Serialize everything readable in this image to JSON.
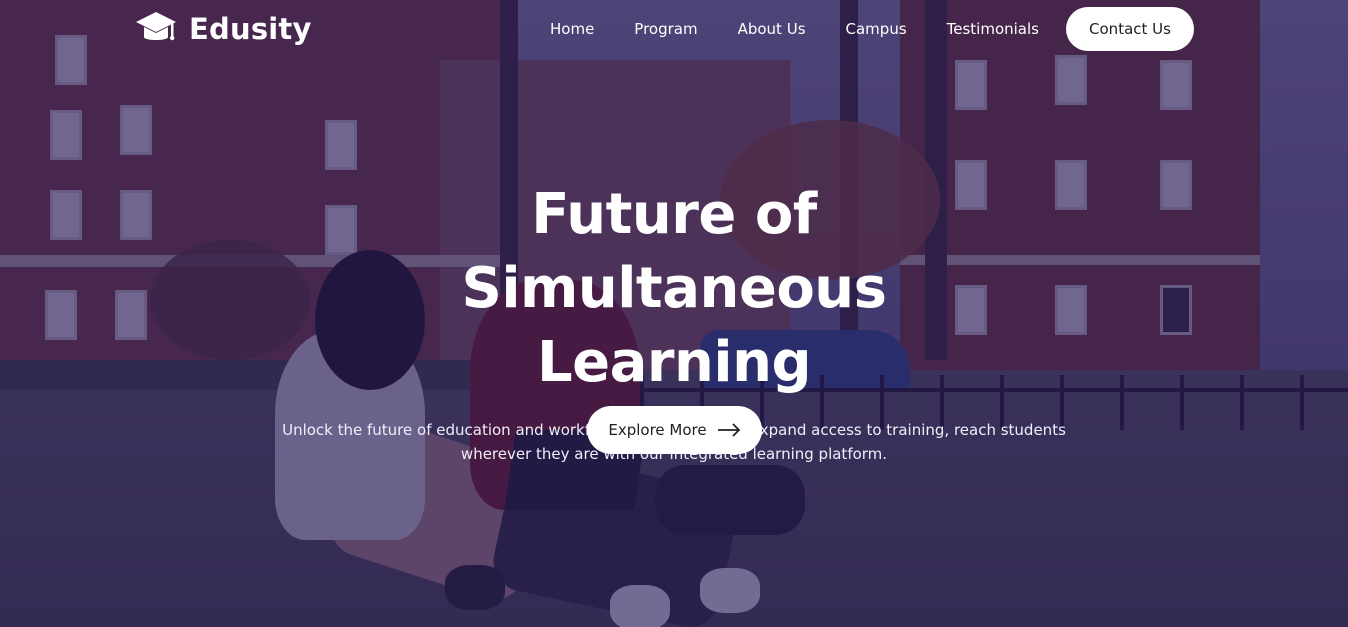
{
  "brand": {
    "name": "Edusity",
    "logo_icon": "graduation-cap-icon"
  },
  "nav": {
    "items": [
      {
        "label": "Home"
      },
      {
        "label": "Program"
      },
      {
        "label": "About Us"
      },
      {
        "label": "Campus"
      },
      {
        "label": "Testimonials"
      }
    ],
    "contact_label": "Contact Us"
  },
  "hero": {
    "title_line1": "Future of Simultaneous",
    "title_line2": "Learning",
    "subtitle": "Unlock the future of education and workforce development to expand access to training, reach students wherever they are with our integrated learning platform.",
    "cta_label": "Explore More",
    "cta_icon": "arrow-right-icon"
  },
  "colors": {
    "overlay": "#26185a",
    "button_bg": "#ffffff",
    "button_text": "#212121",
    "text": "#ffffff"
  }
}
